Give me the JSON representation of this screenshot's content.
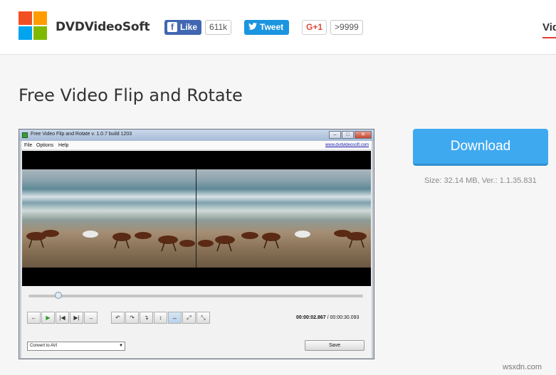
{
  "header": {
    "brand": "DVDVideoSoft",
    "facebook": {
      "label": "Like",
      "count": "611k"
    },
    "twitter": {
      "label": "Tweet"
    },
    "gplus": {
      "label": "G+1",
      "count": ">9999"
    },
    "nav_tab": "Vid"
  },
  "page": {
    "title": "Free Video Flip and Rotate",
    "download_label": "Download",
    "size_info": "Size: 32.14 MB, Ver.: 1.1.35.831"
  },
  "app_window": {
    "title": "Free Video Flip and Rotate v. 1.0.7 build 1203",
    "menu": [
      "File",
      "Options",
      "Help"
    ],
    "site_link": "www.dvdvideosoft.com",
    "playback_progress": 0.09,
    "controls": {
      "nav": [
        "←",
        "▶",
        "|◀",
        "▶|",
        "→"
      ],
      "rotate": [
        "↶",
        "↷",
        "↴",
        "↕",
        "↔",
        "⤢",
        "⤡"
      ]
    },
    "time_current": "00:00:02.867",
    "time_total": "/ 00:00:30.093",
    "format_select": "Convert to AVI",
    "save_label": "Save"
  },
  "watermark": "wsxdn.com",
  "icons": {
    "facebook": "facebook-icon",
    "twitter": "twitter-bird-icon"
  },
  "colors": {
    "download": "#3fa9f0",
    "facebook": "#4267b2",
    "twitter": "#1b95e0",
    "gplus": "#dd4b39",
    "nav_underline": "#e53935"
  }
}
